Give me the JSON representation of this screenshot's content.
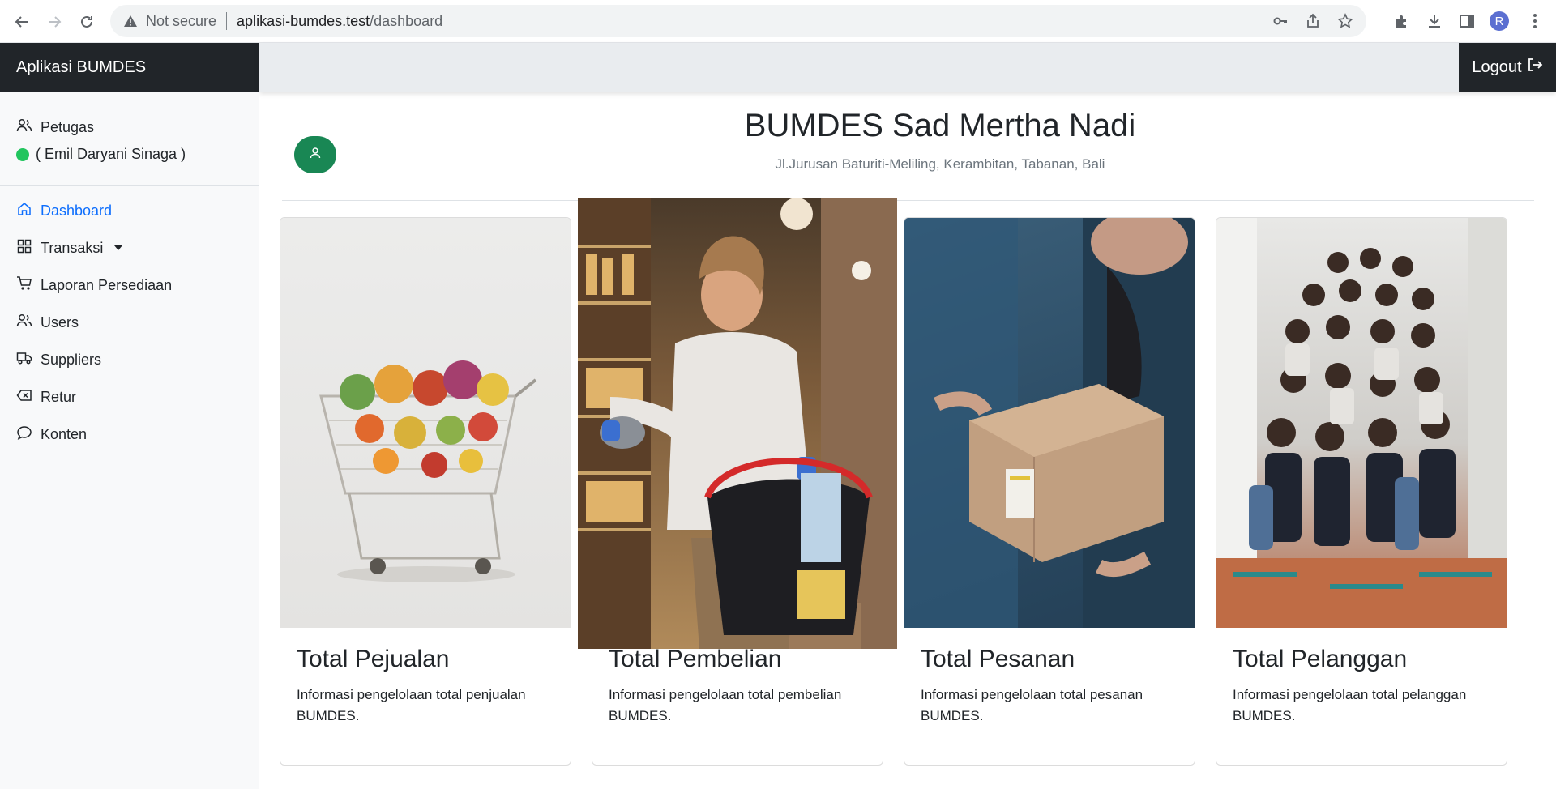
{
  "browser": {
    "not_secure": "Not secure",
    "url_host": "aplikasi-bumdes.test",
    "url_path": "/dashboard",
    "profile_initial": "R"
  },
  "app": {
    "brand": "Aplikasi BUMDES",
    "logout_label": "Logout"
  },
  "sidebar": {
    "role": "Petugas",
    "user_name": "( Emil Daryani Sinaga )",
    "items": [
      {
        "label": "Dashboard",
        "icon": "home-icon"
      },
      {
        "label": "Transaksi",
        "icon": "grid-icon"
      },
      {
        "label": "Laporan Persediaan",
        "icon": "cart-icon"
      },
      {
        "label": "Users",
        "icon": "users-icon"
      },
      {
        "label": "Suppliers",
        "icon": "truck-icon"
      },
      {
        "label": "Retur",
        "icon": "backspace-icon"
      },
      {
        "label": "Konten",
        "icon": "chat-icon"
      }
    ]
  },
  "main": {
    "title": "BUMDES Sad Mertha Nadi",
    "subtitle": "Jl.Jurusan Baturiti-Meliling, Kerambitan, Tabanan, Bali",
    "cards": [
      {
        "title": "Total Pejualan",
        "text": "Informasi pengelolaan total penjualan BUMDES."
      },
      {
        "title": "Total Pembelian",
        "text": "Informasi pengelolaan total pembelian BUMDES."
      },
      {
        "title": "Total Pesanan",
        "text": "Informasi pengelolaan total pesanan BUMDES."
      },
      {
        "title": "Total Pelanggan",
        "text": "Informasi pengelolaan total pelanggan BUMDES."
      }
    ]
  },
  "colors": {
    "dark": "#212529",
    "active": "#0d6efd",
    "online": "#22c55e",
    "profile_badge": "#198754"
  }
}
